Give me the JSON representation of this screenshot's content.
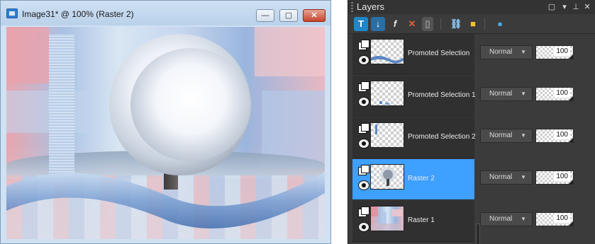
{
  "image_window": {
    "title": "Image31* @ 100% (Raster 2)",
    "buttons": {
      "minimize": "—",
      "maximize": "▢",
      "close": "✕"
    }
  },
  "layers_panel": {
    "title": "Layers",
    "header_icons": [
      "restore-icon",
      "dropdown-icon",
      "pin-icon",
      "close-icon"
    ],
    "toolbar_icons": [
      "new-raster-layer-icon",
      "new-vector-layer-icon",
      "new-adjustment-layer-icon",
      "delete-layer-icon",
      "layer-properties-icon",
      "link-layers-icon",
      "lock-transparency-icon",
      "edit-selection-icon"
    ],
    "layers": [
      {
        "name": "Promoted Selection",
        "blend": "Normal",
        "opacity": "100",
        "selected": false
      },
      {
        "name": "Promoted Selection 1",
        "blend": "Normal",
        "opacity": "100",
        "selected": false
      },
      {
        "name": "Promoted Selection 2",
        "blend": "Normal",
        "opacity": "100",
        "selected": false
      },
      {
        "name": "Raster 2",
        "blend": "Normal",
        "opacity": "100",
        "selected": true
      },
      {
        "name": "Raster 1",
        "blend": "Normal",
        "opacity": "100",
        "selected": false
      }
    ]
  },
  "colors": {
    "selected_row": "#3ea0ff",
    "panel_bg": "#3b3b3b",
    "title_bar": "#cfe1f3"
  }
}
